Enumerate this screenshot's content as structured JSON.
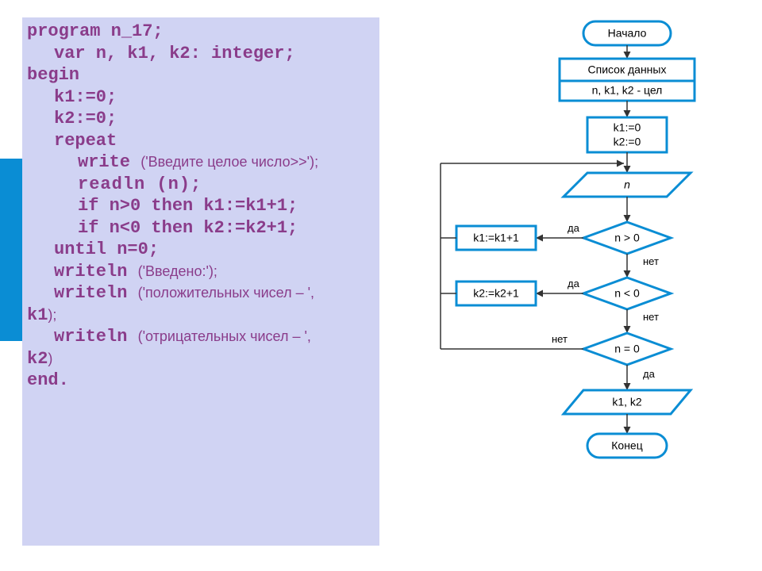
{
  "code": {
    "l1a": "program",
    "l1b": " n_17;",
    "l2a": "var",
    "l2b": " n, k1, k2: integer;",
    "l3": "begin",
    "l4": "k1:=0;",
    "l5": "k2:=0;",
    "l6": "repeat",
    "l7a": "write ",
    "l7b": "('Введите целое число>>');",
    "l8": "readln (n);",
    "l9a": "if",
    "l9b": " n>0 ",
    "l9c": "then",
    "l9d": " k1:=k1+1;",
    "l10a": "if",
    "l10b": " n<0 ",
    "l10c": "then",
    "l10d": " k2:=k2+1;",
    "l11a": "until",
    "l11b": " n=0;",
    "l12a": "writeln ",
    "l12b": "('Введено:');",
    "l13a": "writeln ",
    "l13b": "('положительных чисел – ',",
    "l13c": "k1",
    "l13d": ");",
    "l14a": "writeln ",
    "l14b": "('отрицательных чисел – ',",
    "l14c": "k2",
    "l14d": ")",
    "l15": "end."
  },
  "flow": {
    "start": "Начало",
    "data_title": "Список данных",
    "data_vars": "n, k1, k2 - цел",
    "init1": "k1:=0",
    "init2": "k2:=0",
    "input_n": "n",
    "cond1": "n > 0",
    "act1": "k1:=k1+1",
    "cond2": "n < 0",
    "act2": "k2:=k2+1",
    "cond3": "n = 0",
    "output": "k1, k2",
    "end": "Конец",
    "yes": "да",
    "no": "нет"
  }
}
